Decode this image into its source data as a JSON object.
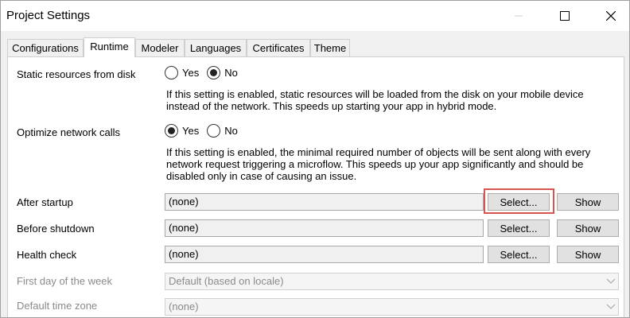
{
  "window": {
    "title": "Project Settings",
    "icons": {
      "minimize": "minimize-icon",
      "maximize": "maximize-icon",
      "close": "close-icon"
    }
  },
  "tabs": [
    {
      "label": "Configurations",
      "active": false
    },
    {
      "label": "Runtime",
      "active": true
    },
    {
      "label": "Modeler",
      "active": false
    },
    {
      "label": "Languages",
      "active": false
    },
    {
      "label": "Certificates",
      "active": false
    },
    {
      "label": "Theme",
      "active": false
    }
  ],
  "runtime": {
    "static_resources": {
      "label": "Static resources from disk",
      "options": [
        "Yes",
        "No"
      ],
      "selected": "No",
      "description": "If this setting is enabled, static resources will be loaded from the disk on your mobile device instead of the network. This speeds up starting your app in hybrid mode."
    },
    "optimize_network": {
      "label": "Optimize network calls",
      "options": [
        "Yes",
        "No"
      ],
      "selected": "Yes",
      "description": "If this setting is enabled, the minimal required number of objects will be sent along with every network request triggering a microflow. This speeds up your app significantly and should be disabled only in case of causing an issue."
    },
    "after_startup": {
      "label": "After startup",
      "value": "(none)",
      "select_label": "Select...",
      "show_label": "Show"
    },
    "before_shutdown": {
      "label": "Before shutdown",
      "value": "(none)",
      "select_label": "Select...",
      "show_label": "Show"
    },
    "health_check": {
      "label": "Health check",
      "value": "(none)",
      "select_label": "Select...",
      "show_label": "Show"
    },
    "first_day": {
      "label": "First day of the week",
      "value": "Default (based on locale)"
    },
    "time_zone": {
      "label": "Default time zone",
      "value": "(none)"
    }
  },
  "colors": {
    "highlight": "#d9534f"
  }
}
